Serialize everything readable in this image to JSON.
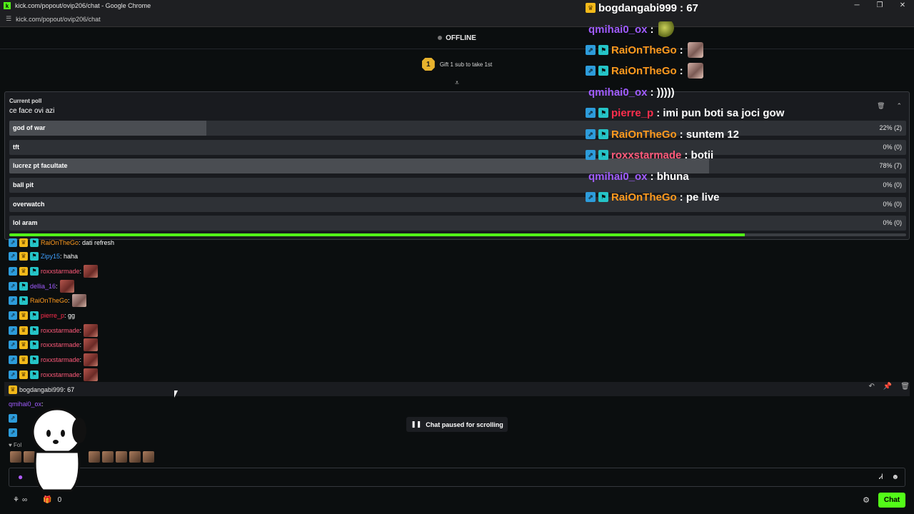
{
  "browser": {
    "title": "kick.com/popout/ovip206/chat - Google Chrome",
    "url": "kick.com/popout/ovip206/chat"
  },
  "header": {
    "status": "OFFLINE"
  },
  "gift": {
    "badge": "1",
    "text": "Gift 1 sub to take 1st"
  },
  "poll": {
    "label": "Current poll",
    "question": "ce face ovi azi",
    "progress": 0.82,
    "options": [
      {
        "label": "god of war",
        "pct": "22% (2)",
        "fraction": 0.22
      },
      {
        "label": "tft",
        "pct": "0% (0)",
        "fraction": 0
      },
      {
        "label": "lucrez pt facultate",
        "pct": "78% (7)",
        "fraction": 0.78
      },
      {
        "label": "ball pit",
        "pct": "0% (0)",
        "fraction": 0
      },
      {
        "label": "overwatch",
        "pct": "0% (0)",
        "fraction": 0
      },
      {
        "label": "lol aram",
        "pct": "0% (0)",
        "fraction": 0
      }
    ]
  },
  "chat": {
    "messages": [
      {
        "user": "RaiOnTheGo",
        "text": ": dati refresh"
      },
      {
        "user": "Zipy15",
        "text": ": haha"
      },
      {
        "user": "roxxstarmade",
        "text": ":"
      },
      {
        "user": "dellia_16",
        "text": ":"
      },
      {
        "user": "RaiOnTheGo",
        "text": ":"
      },
      {
        "user": "pierre_p",
        "text": ": gg"
      },
      {
        "user": "roxxstarmade",
        "text": ":"
      },
      {
        "user": "roxxstarmade",
        "text": ":"
      },
      {
        "user": "roxxstarmade",
        "text": ":"
      },
      {
        "user": "roxxstarmade",
        "text": ":"
      },
      {
        "user": "bogdangabi999",
        "text": ": 67"
      },
      {
        "user": "qmihai0_ox",
        "text": ":"
      }
    ],
    "paused": "Chat paused for scrolling",
    "followers_label": "Fol",
    "bottom_count": "0",
    "chat_button": "Chat"
  },
  "overlay": {
    "messages": [
      {
        "user": "bogdangabi999",
        "text": ": 67"
      },
      {
        "user": "qmihai0_ox",
        "text": ":"
      },
      {
        "user": "RaiOnTheGo",
        "text": ":"
      },
      {
        "user": "RaiOnTheGo",
        "text": ":"
      },
      {
        "user": "qmihai0_ox",
        "text": ": )))))"
      },
      {
        "user": "pierre_p",
        "text": ": imi pun boti sa joci gow"
      },
      {
        "user": "RaiOnTheGo",
        "text": ": suntem 12"
      },
      {
        "user": "roxxstarmade",
        "text": ": botii"
      },
      {
        "user": "qmihai0_ox",
        "text": ": bhuna"
      },
      {
        "user": "RaiOnTheGo",
        "text": ": pe live"
      }
    ]
  },
  "colors": {
    "accent": "#53fc18",
    "og": "#2d9cdb",
    "crown": "#f3b91a",
    "mod": "#25c4c7"
  },
  "icons": [
    "kick-logo-icon",
    "tune-icon",
    "minimize-icon",
    "maximize-icon",
    "close-icon",
    "collapse-icon",
    "trash-icon",
    "chevron-up-icon",
    "reply-icon",
    "pin-icon",
    "delete-icon",
    "pause-icon",
    "mic-icon",
    "translate-icon",
    "emoji-icon",
    "gear-icon",
    "infinity-icon",
    "gift-icon"
  ]
}
